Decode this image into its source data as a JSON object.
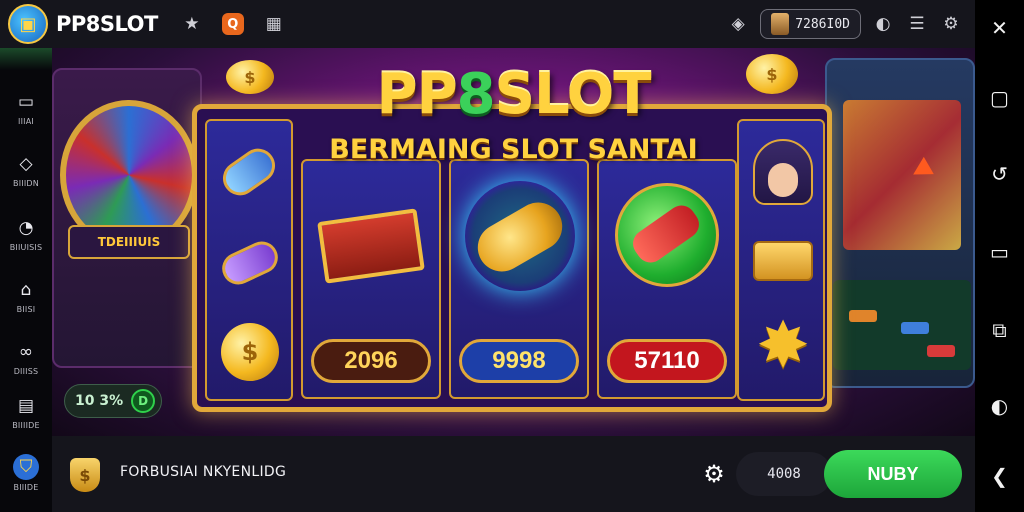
{
  "app": {
    "brand": "PP8SLOT",
    "logo_icon": "wallet-icon"
  },
  "topbar": {
    "icons": [
      "star-icon",
      "image-gallery-icon"
    ],
    "badge_label": "Q",
    "balance": "7286I0D",
    "right_icons": [
      "chip-icon",
      "toggle-icon",
      "menu-icon",
      "settings-icon"
    ]
  },
  "sidebar": {
    "items": [
      {
        "icon": "monitor-icon",
        "label": "IIIAI"
      },
      {
        "icon": "chat-icon",
        "label": "BIIIDN"
      },
      {
        "icon": "clock-icon",
        "label": "BIIUISIS"
      },
      {
        "icon": "bookmark-icon",
        "label": "BIISI"
      },
      {
        "icon": "link-icon",
        "label": "DIIISS"
      },
      {
        "icon": "grid-icon",
        "label": "BIIIIDE"
      },
      {
        "icon": "shield-icon",
        "label": "BIIIDE"
      }
    ]
  },
  "rail": {
    "icons": [
      "close-icon",
      "square-icon",
      "refresh-icon",
      "window-icon",
      "resize-icon",
      "rotate-icon",
      "back-icon"
    ]
  },
  "game": {
    "title_prefix": "PP",
    "title_eight": "8",
    "title_suffix": "SLOT",
    "subtitle": "BERMAING SLOT SANTAI",
    "left_machine_label": "TDEIIIUIS",
    "pills": [
      "2096",
      "9998",
      "57110"
    ],
    "counter_text": "10 3%",
    "counter_button": "D",
    "symbols": [
      "capsule-icon",
      "purple-potion-icon",
      "gold-coin-icon",
      "treasure-chest-icon",
      "orb-icon",
      "lipstick-icon",
      "character-face-icon",
      "gold-bar-icon",
      "star-icon"
    ]
  },
  "bottombar": {
    "title": "FORBUSIAI NKYENLIDG",
    "amount": "4008",
    "cta_label": "NUBY"
  },
  "colors": {
    "accent_gold": "#ffd23f",
    "accent_green": "#2fd14b",
    "stage_magenta": "#c01f86",
    "topbar_bg": "#15151c"
  }
}
